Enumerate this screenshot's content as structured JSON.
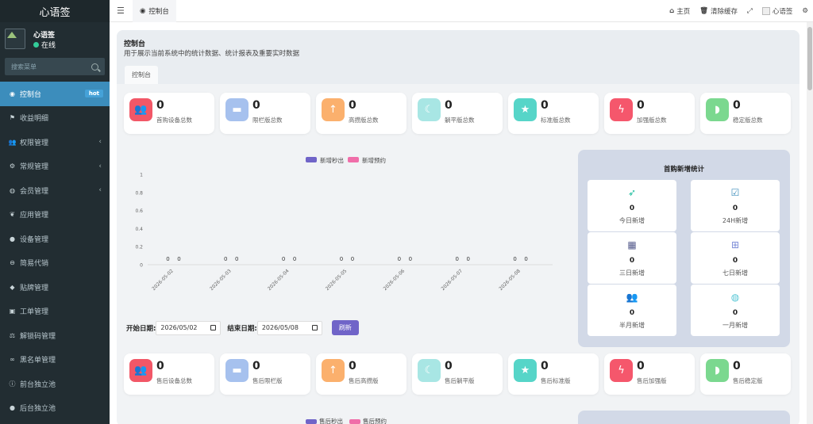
{
  "sidebar": {
    "logo": "心语签",
    "user": {
      "name": "心语签",
      "status": "在线"
    },
    "search_placeholder": "搜索菜单",
    "items": [
      {
        "label": "控制台",
        "icon": "dashboard-icon",
        "badge": "hot",
        "active": true
      },
      {
        "label": "收益明细",
        "icon": "flag-icon"
      },
      {
        "label": "权限管理",
        "icon": "users-icon",
        "expandable": true
      },
      {
        "label": "常规管理",
        "icon": "cogs-icon",
        "expandable": true
      },
      {
        "label": "会员管理",
        "icon": "user-circle-icon",
        "expandable": true
      },
      {
        "label": "应用管理",
        "icon": "leaf-icon"
      },
      {
        "label": "设备管理",
        "icon": "circle-icon"
      },
      {
        "label": "简易代销",
        "icon": "minus-circle-icon"
      },
      {
        "label": "贴牌管理",
        "icon": "tag-icon"
      },
      {
        "label": "工单管理",
        "icon": "briefcase-icon"
      },
      {
        "label": "解锁码管理",
        "icon": "balance-scale-icon"
      },
      {
        "label": "黑名单管理",
        "icon": "binoculars-icon"
      },
      {
        "label": "前台独立池",
        "icon": "info-circle-icon"
      },
      {
        "label": "后台独立池",
        "icon": "apple-icon"
      }
    ]
  },
  "topbar": {
    "tab": "控制台",
    "home": "主页",
    "clear_cache": "清除缓存",
    "username": "心语签"
  },
  "page": {
    "title": "控制台",
    "desc": "用于展示当前系统中的统计数据、统计报表及重要实时数据",
    "tab": "控制台"
  },
  "stats": [
    {
      "value": "0",
      "label": "首购设备总数",
      "icon": "users-icon",
      "color": "#f25767"
    },
    {
      "value": "0",
      "label": "限栏版总数",
      "icon": "bed-icon",
      "color": "#a6c1ee"
    },
    {
      "value": "0",
      "label": "高攒版总数",
      "icon": "arrow-up-icon",
      "color": "#fbb06d"
    },
    {
      "value": "0",
      "label": "躺平版总数",
      "icon": "moon-icon",
      "color": "#a8e6e4"
    },
    {
      "value": "0",
      "label": "标准版总数",
      "icon": "star-icon",
      "color": "#56d5c8"
    },
    {
      "value": "0",
      "label": "加强版总数",
      "icon": "bolt-icon",
      "color": "#f5576c"
    },
    {
      "value": "0",
      "label": "稳定版总数",
      "icon": "shield-icon",
      "color": "#7bd88f"
    }
  ],
  "stats2": [
    {
      "value": "0",
      "label": "售后设备总数",
      "icon": "users-icon",
      "color": "#f25767"
    },
    {
      "value": "0",
      "label": "售后限栏版",
      "icon": "bed-icon",
      "color": "#a6c1ee"
    },
    {
      "value": "0",
      "label": "售后高攒版",
      "icon": "arrow-up-icon",
      "color": "#fbb06d"
    },
    {
      "value": "0",
      "label": "售后躺平版",
      "icon": "moon-icon",
      "color": "#a8e6e4"
    },
    {
      "value": "0",
      "label": "售后标准版",
      "icon": "star-icon",
      "color": "#56d5c8"
    },
    {
      "value": "0",
      "label": "售后加强版",
      "icon": "bolt-icon",
      "color": "#f5576c"
    },
    {
      "value": "0",
      "label": "售后稳定版",
      "icon": "shield-icon",
      "color": "#7bd88f"
    }
  ],
  "chart_data": [
    {
      "type": "bar",
      "categories": [
        "2026-05-02",
        "2026-05-03",
        "2026-05-04",
        "2026-05-05",
        "2026-05-06",
        "2026-05-07",
        "2026-05-08"
      ],
      "series": [
        {
          "name": "新增秒出",
          "values": [
            0,
            0,
            0,
            0,
            0,
            0,
            0
          ],
          "color": "#7064c8"
        },
        {
          "name": "新增预约",
          "values": [
            0,
            0,
            0,
            0,
            0,
            0,
            0
          ],
          "color": "#f06ea9"
        }
      ],
      "ylim": [
        0,
        1
      ],
      "yticks": [
        "0",
        "0.2",
        "0.4",
        "0.6",
        "0.8",
        "1"
      ],
      "legend": "top-center"
    }
  ],
  "daterange": {
    "start_label": "开始日期:",
    "start_value": "2026/05/02",
    "end_label": "结束日期:",
    "end_value": "2026/05/08",
    "refresh": "刷新"
  },
  "side_panel": {
    "title": "首购新增统计",
    "items": [
      {
        "icon": "rocket-icon",
        "value": "0",
        "label": "今日新增",
        "color": "#1abc9c"
      },
      {
        "icon": "calendar-check-icon",
        "value": "0",
        "label": "24H新增",
        "color": "#3c8dbc"
      },
      {
        "icon": "calendar-icon",
        "value": "0",
        "label": "三日新增",
        "color": "#555b8c"
      },
      {
        "icon": "calendar-plus-icon",
        "value": "0",
        "label": "七日新增",
        "color": "#7a8ad6"
      },
      {
        "icon": "users-icon",
        "value": "0",
        "label": "半月新增",
        "color": "#7bd88f"
      },
      {
        "icon": "user-circle-icon",
        "value": "0",
        "label": "一月新增",
        "color": "#56c6d5"
      }
    ]
  },
  "chart2_legend": [
    "售后秒出",
    "售后预约"
  ]
}
